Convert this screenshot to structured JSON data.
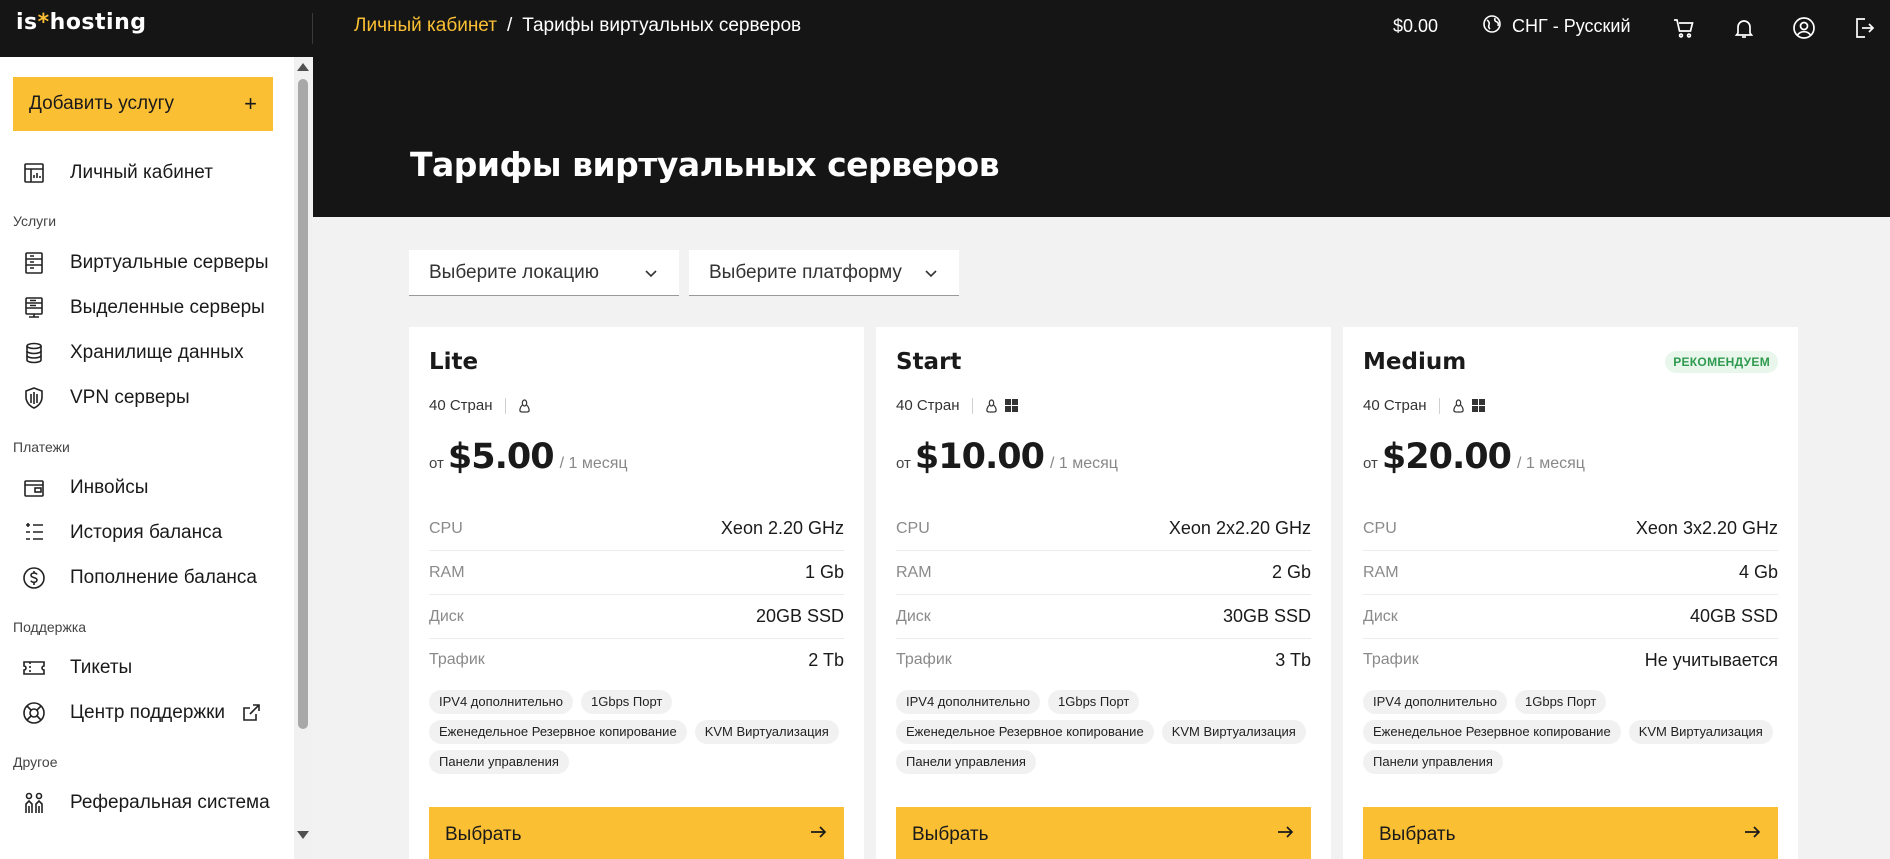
{
  "header": {
    "logo_prefix": "is",
    "logo_star": "*",
    "logo_suffix": "hosting",
    "breadcrumb": {
      "home": "Личный кабинет",
      "separator": "/",
      "current": "Тарифы виртуальных серверов"
    },
    "balance": "$0.00",
    "language": "СНГ - Русский",
    "icons": [
      "globe-icon",
      "cart-icon",
      "bell-icon",
      "account-icon",
      "logout-icon"
    ]
  },
  "sidebar": {
    "add_service": "Добавить услугу",
    "add_service_icon": "+",
    "dashboard": "Личный кабинет",
    "sections": {
      "services": "Услуги",
      "payments": "Платежи",
      "support": "Поддержка",
      "other": "Другое"
    },
    "items": {
      "vps": "Виртуальные серверы",
      "dedicated": "Выделенные серверы",
      "storage": "Хранилище данных",
      "vpn": "VPN серверы",
      "invoices": "Инвойсы",
      "balance_history": "История баланса",
      "top_up": "Пополнение баланса",
      "tickets": "Тикеты",
      "help_center": "Центр поддержки",
      "referral": "Реферальная система"
    }
  },
  "page": {
    "title": "Тарифы виртуальных серверов",
    "filters": {
      "location": "Выберите локацию",
      "platform": "Выберите платформу"
    }
  },
  "plans": [
    {
      "name": "Lite",
      "badge": "",
      "countries": "40 Стран",
      "price_from": "от",
      "price": "$5.00",
      "period": "/ 1 месяц",
      "specs": [
        {
          "label": "CPU",
          "value": "Xeon 2.20 GHz"
        },
        {
          "label": "RAM",
          "value": "1 Gb"
        },
        {
          "label": "Диск",
          "value": "20GB SSD"
        },
        {
          "label": "Трафик",
          "value": "2 Tb"
        }
      ],
      "tags": [
        "IPV4 дополнительно",
        "1Gbps Порт",
        "Еженедельное Резервное копирование",
        "KVM Виртуализация",
        "Панели управления"
      ],
      "button": "Выбрать"
    },
    {
      "name": "Start",
      "badge": "",
      "countries": "40 Стран",
      "price_from": "от",
      "price": "$10.00",
      "period": "/ 1 месяц",
      "specs": [
        {
          "label": "CPU",
          "value": "Xeon 2x2.20 GHz"
        },
        {
          "label": "RAM",
          "value": "2 Gb"
        },
        {
          "label": "Диск",
          "value": "30GB SSD"
        },
        {
          "label": "Трафик",
          "value": "3 Tb"
        }
      ],
      "tags": [
        "IPV4 дополнительно",
        "1Gbps Порт",
        "Еженедельное Резервное копирование",
        "KVM Виртуализация",
        "Панели управления"
      ],
      "button": "Выбрать"
    },
    {
      "name": "Medium",
      "badge": "РЕКОМЕНДУЕМ",
      "countries": "40 Стран",
      "price_from": "от",
      "price": "$20.00",
      "period": "/ 1 месяц",
      "specs": [
        {
          "label": "CPU",
          "value": "Xeon 3x2.20 GHz"
        },
        {
          "label": "RAM",
          "value": "4 Gb"
        },
        {
          "label": "Диск",
          "value": "40GB SSD"
        },
        {
          "label": "Трафик",
          "value": "Не учитывается"
        }
      ],
      "tags": [
        "IPV4 дополнительно",
        "1Gbps Порт",
        "Еженедельное Резервное копирование",
        "KVM Виртуализация",
        "Панели управления"
      ],
      "button": "Выбрать"
    }
  ],
  "colors": {
    "accent": "#fbbf34",
    "dark": "#151515",
    "badge_green": "#2e9a4e"
  }
}
